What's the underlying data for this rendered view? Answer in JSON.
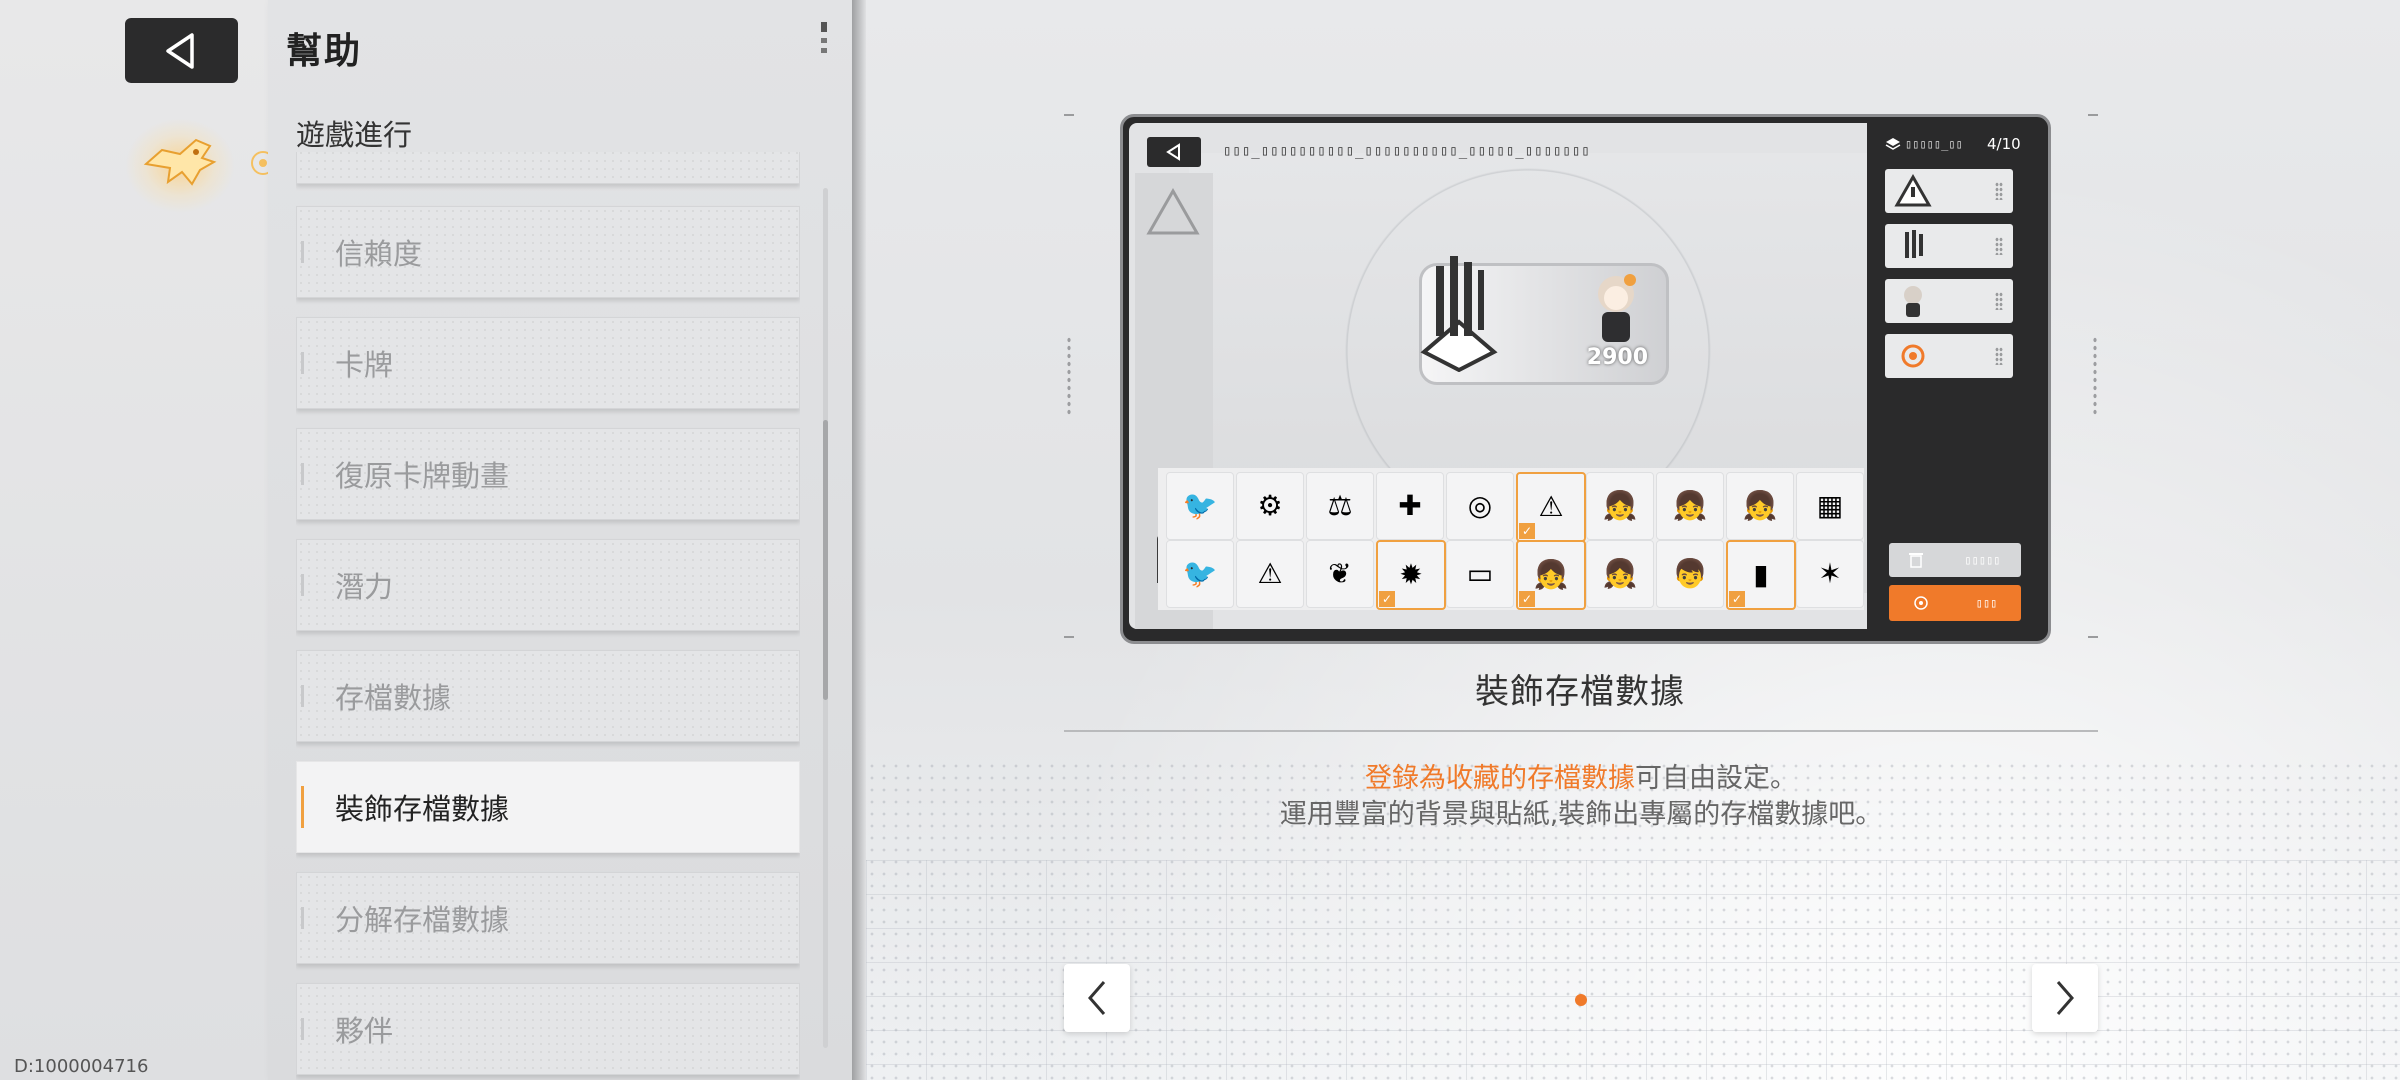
{
  "app": {
    "title": "幫助",
    "section": "遊戲進行",
    "id_text": "D:1000004716"
  },
  "menu": {
    "items": [
      {
        "label": "信賴度",
        "active": false
      },
      {
        "label": "卡牌",
        "active": false
      },
      {
        "label": "復原卡牌動畫",
        "active": false
      },
      {
        "label": "潛力",
        "active": false
      },
      {
        "label": "存檔數據",
        "active": false
      },
      {
        "label": "裝飾存檔數據",
        "active": true
      },
      {
        "label": "分解存檔數據",
        "active": false
      },
      {
        "label": "夥伴",
        "active": false
      }
    ]
  },
  "preview": {
    "card_value": "2900",
    "slot_count": "4/10",
    "stickers_row1": [
      "🐦",
      "⚙",
      "⚖",
      "✚",
      "◎",
      "⚠",
      "👧",
      "👧",
      "👧",
      "▦"
    ],
    "stickers_row2": [
      "🐦",
      "⚠",
      "❦",
      "✹",
      "▭",
      "👧",
      "👧",
      "👦",
      "▮",
      "✶"
    ],
    "selected_row1": [
      5
    ],
    "selected_row2": [
      3,
      5,
      8
    ]
  },
  "caption": {
    "title": "裝飾存檔數據",
    "highlight": "登錄為收藏的存檔數據",
    "line1_rest": "可自由設定。",
    "line2": "運用豐富的背景與貼紙,裝飾出專屬的存檔數據吧。"
  },
  "colors": {
    "accent": "#f07a2a",
    "active_bar": "#f0a040",
    "dark_button": "#2b2b2c"
  },
  "icons": {
    "back": "back-triangle-icon",
    "mascot": "mascot-icon",
    "prev": "chevron-left-icon",
    "next": "chevron-right-icon"
  }
}
